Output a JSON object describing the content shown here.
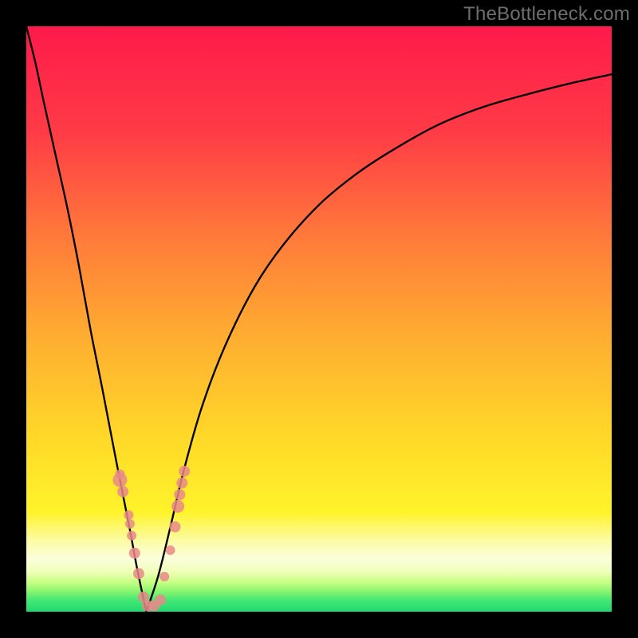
{
  "watermark": "TheBottleneck.com",
  "colors": {
    "bg_black": "#000000",
    "grad_top": "#ff1a4b",
    "grad_mid_upper": "#ff5c3e",
    "grad_mid": "#ffb030",
    "grad_mid_lower": "#ffe424",
    "grad_band_light": "#ffffb0",
    "grad_green": "#2be06a",
    "curve": "#050505",
    "dot_fill": "#e98a8a",
    "dot_stroke": "#c25353"
  },
  "chart_data": {
    "type": "line",
    "title": "",
    "xlabel": "",
    "ylabel": "",
    "x_range": [
      0,
      1
    ],
    "y_range": [
      0,
      1
    ],
    "notch_x": 0.205,
    "curve_y_top": 1.0,
    "left_branch": [
      {
        "x": 0.0,
        "y": 1.0
      },
      {
        "x": 0.015,
        "y": 0.94
      },
      {
        "x": 0.03,
        "y": 0.87
      },
      {
        "x": 0.05,
        "y": 0.78
      },
      {
        "x": 0.07,
        "y": 0.69
      },
      {
        "x": 0.09,
        "y": 0.59
      },
      {
        "x": 0.11,
        "y": 0.48
      },
      {
        "x": 0.13,
        "y": 0.38
      },
      {
        "x": 0.155,
        "y": 0.25
      },
      {
        "x": 0.175,
        "y": 0.15
      },
      {
        "x": 0.19,
        "y": 0.07
      },
      {
        "x": 0.205,
        "y": 0.0
      }
    ],
    "right_branch": [
      {
        "x": 0.205,
        "y": 0.0
      },
      {
        "x": 0.225,
        "y": 0.06
      },
      {
        "x": 0.245,
        "y": 0.14
      },
      {
        "x": 0.27,
        "y": 0.245
      },
      {
        "x": 0.3,
        "y": 0.35
      },
      {
        "x": 0.34,
        "y": 0.455
      },
      {
        "x": 0.39,
        "y": 0.555
      },
      {
        "x": 0.44,
        "y": 0.628
      },
      {
        "x": 0.5,
        "y": 0.695
      },
      {
        "x": 0.56,
        "y": 0.745
      },
      {
        "x": 0.62,
        "y": 0.785
      },
      {
        "x": 0.7,
        "y": 0.83
      },
      {
        "x": 0.78,
        "y": 0.862
      },
      {
        "x": 0.86,
        "y": 0.885
      },
      {
        "x": 0.94,
        "y": 0.905
      },
      {
        "x": 1.0,
        "y": 0.918
      }
    ],
    "dots": [
      {
        "x": 0.165,
        "y": 0.205,
        "r": 7
      },
      {
        "x": 0.16,
        "y": 0.225,
        "r": 9
      },
      {
        "x": 0.175,
        "y": 0.165,
        "r": 6
      },
      {
        "x": 0.16,
        "y": 0.235,
        "r": 6
      },
      {
        "x": 0.177,
        "y": 0.15,
        "r": 6
      },
      {
        "x": 0.185,
        "y": 0.1,
        "r": 7
      },
      {
        "x": 0.192,
        "y": 0.065,
        "r": 7
      },
      {
        "x": 0.18,
        "y": 0.13,
        "r": 6
      },
      {
        "x": 0.2,
        "y": 0.025,
        "r": 7
      },
      {
        "x": 0.207,
        "y": 0.01,
        "r": 7
      },
      {
        "x": 0.218,
        "y": 0.01,
        "r": 7
      },
      {
        "x": 0.229,
        "y": 0.02,
        "r": 7
      },
      {
        "x": 0.236,
        "y": 0.06,
        "r": 6
      },
      {
        "x": 0.246,
        "y": 0.105,
        "r": 6
      },
      {
        "x": 0.254,
        "y": 0.145,
        "r": 7
      },
      {
        "x": 0.259,
        "y": 0.18,
        "r": 8
      },
      {
        "x": 0.262,
        "y": 0.2,
        "r": 7
      },
      {
        "x": 0.266,
        "y": 0.22,
        "r": 7
      },
      {
        "x": 0.27,
        "y": 0.24,
        "r": 7
      }
    ]
  }
}
